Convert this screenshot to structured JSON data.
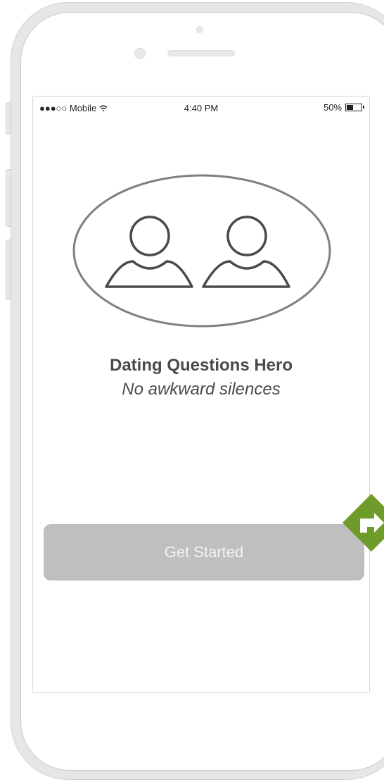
{
  "status_bar": {
    "carrier": "●●●○○ Mobile",
    "time": "4:40 PM",
    "battery": "50%",
    "battery_level": 0.5
  },
  "hero": {
    "icon": "two-users-icon",
    "title": "Dating Questions Hero",
    "tagline": "No awkward silences"
  },
  "cta": {
    "label": "Get Started"
  },
  "icons": {
    "wifi": "wifi-icon",
    "battery": "battery-icon",
    "link": "link-arrow-icon"
  },
  "colors": {
    "button_bg": "#bfbfbf",
    "button_text": "#f4f4f4",
    "text": "#4a4a4a",
    "link_badge": "#6f9b2a"
  }
}
